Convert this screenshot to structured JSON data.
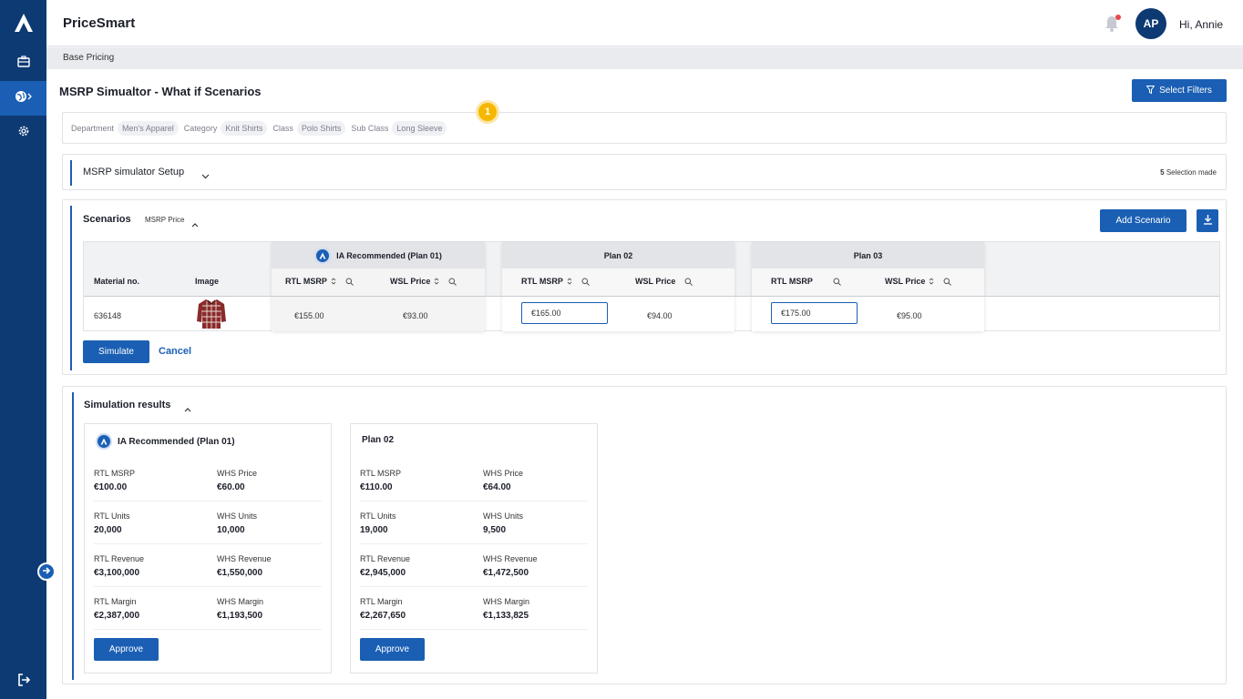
{
  "app": {
    "title": "PriceSmart"
  },
  "header": {
    "avatar_initials": "AP",
    "greeting": "Hi, Annie"
  },
  "breadcrumb": "Base Pricing",
  "page": {
    "title": "MSRP Simualtor - What if Scenarios",
    "select_filters_label": "Select Filters"
  },
  "filters": [
    {
      "label": "Department",
      "value": "Men's Apparel"
    },
    {
      "label": "Category",
      "value": "Knit Shirts"
    },
    {
      "label": "Class",
      "value": "Polo Shirts"
    },
    {
      "label": "Sub Class",
      "value": "Long Sleeve"
    }
  ],
  "step_badge": "1",
  "setup": {
    "title": "MSRP simulator Setup",
    "selection_count": "5",
    "selection_text": "Selection made"
  },
  "scenarios": {
    "title": "Scenarios",
    "subtitle": "MSRP Price",
    "add_label": "Add Scenario",
    "columns": {
      "material": "Material no.",
      "image": "Image",
      "rtl_msrp": "RTL MSRP",
      "wsl_price": "WSL Price"
    },
    "plans": [
      {
        "name": "IA Recommended (Plan 01)",
        "rtl_msrp": "€155.00",
        "wsl_price": "€93.00"
      },
      {
        "name": "Plan 02",
        "rtl_msrp": "€165.00",
        "wsl_price": "€94.00"
      },
      {
        "name": "Plan 03",
        "rtl_msrp": "€175.00",
        "wsl_price": "€95.00"
      }
    ],
    "row": {
      "material_no": "636148"
    },
    "simulate_label": "Simulate",
    "cancel_label": "Cancel"
  },
  "results": {
    "title": "Simulation results",
    "approve_label": "Approve",
    "cards": [
      {
        "name": "IA Recommended (Plan 01)",
        "metrics": [
          {
            "label": "RTL MSRP",
            "value": "€100.00"
          },
          {
            "label": "WHS Price",
            "value": "€60.00"
          },
          {
            "label": "RTL Units",
            "value": "20,000"
          },
          {
            "label": "WHS Units",
            "value": "10,000"
          },
          {
            "label": "RTL Revenue",
            "value": "€3,100,000"
          },
          {
            "label": "WHS Revenue",
            "value": "€1,550,000"
          },
          {
            "label": "RTL Margin",
            "value": "€2,387,000"
          },
          {
            "label": "WHS Margin",
            "value": "€1,193,500"
          }
        ]
      },
      {
        "name": "Plan 02",
        "metrics": [
          {
            "label": "RTL MSRP",
            "value": "€110.00"
          },
          {
            "label": "WHS Price",
            "value": "€64.00"
          },
          {
            "label": "RTL Units",
            "value": "19,000"
          },
          {
            "label": "WHS Units",
            "value": "9,500"
          },
          {
            "label": "RTL Revenue",
            "value": "€2,945,000"
          },
          {
            "label": "WHS Revenue",
            "value": "€1,472,500"
          },
          {
            "label": "RTL Margin",
            "value": "€2,267,650"
          },
          {
            "label": "WHS Margin",
            "value": "€1,133,825"
          }
        ]
      }
    ]
  },
  "colors": {
    "primary": "#1a5fb4",
    "sidebar": "#0d3a73",
    "badge": "#f5b800",
    "notification": "#e5484d"
  },
  "icons": {
    "sidebar": [
      "logo-icon",
      "briefcase-icon",
      "globe-icon",
      "gear-icon",
      "logout-icon"
    ],
    "misc": [
      "bell-icon",
      "filter-icon",
      "download-icon",
      "sort-icon",
      "search-icon",
      "chevron-down-icon",
      "chevron-up-icon",
      "arrow-right-icon",
      "ia-logo-icon"
    ]
  }
}
